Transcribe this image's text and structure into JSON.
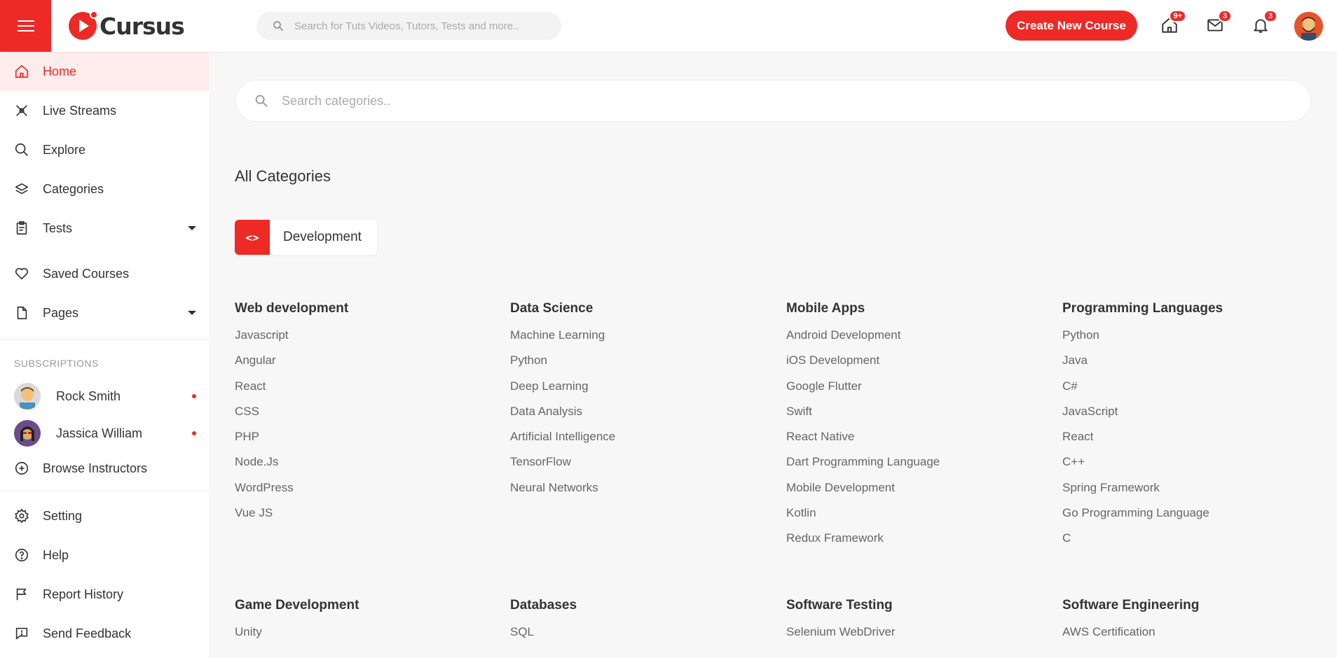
{
  "header": {
    "logo_text": "Cursus",
    "search_placeholder": "Search for Tuts Videos, Tutors, Tests and more..",
    "create_button": "Create New Course",
    "home_badge": "9+",
    "mail_badge": "3",
    "bell_badge": "3",
    "accent_color": "#ed2a26"
  },
  "sidebar": {
    "items": [
      {
        "label": "Home",
        "icon": "home-icon"
      },
      {
        "label": "Live Streams",
        "icon": "live-stream-icon"
      },
      {
        "label": "Explore",
        "icon": "search-icon"
      },
      {
        "label": "Categories",
        "icon": "layers-icon"
      },
      {
        "label": "Tests",
        "icon": "clipboard-icon"
      },
      {
        "label": "Saved Courses",
        "icon": "heart-icon"
      },
      {
        "label": "Pages",
        "icon": "file-icon"
      }
    ],
    "subscriptions_title": "SUBSCRIPTIONS",
    "subscriptions": [
      {
        "name": "Rock Smith"
      },
      {
        "name": "Jassica William"
      }
    ],
    "browse_instructors": "Browse Instructors",
    "bottom_items": [
      {
        "label": "Setting",
        "icon": "gear-icon"
      },
      {
        "label": "Help",
        "icon": "help-icon"
      },
      {
        "label": "Report History",
        "icon": "flag-icon"
      },
      {
        "label": "Send Feedback",
        "icon": "feedback-icon"
      }
    ]
  },
  "main": {
    "search_placeholder": "Search categories..",
    "title": "All Categories",
    "active_category": "Development",
    "groups": [
      {
        "title": "Web development",
        "items": [
          "Javascript",
          "Angular",
          "React",
          "CSS",
          "PHP",
          "Node.Js",
          "WordPress",
          "Vue JS"
        ]
      },
      {
        "title": "Data Science",
        "items": [
          "Machine Learning",
          "Python",
          "Deep Learning",
          "Data Analysis",
          "Artificial Intelligence",
          "TensorFlow",
          "Neural Networks"
        ]
      },
      {
        "title": "Mobile Apps",
        "items": [
          "Android Development",
          "iOS Development",
          "Google Flutter",
          "Swift",
          "React Native",
          "Dart Programming Language",
          "Mobile Development",
          "Kotlin",
          "Redux Framework"
        ]
      },
      {
        "title": "Programming Languages",
        "items": [
          "Python",
          "Java",
          "C#",
          "JavaScript",
          "React",
          "C++",
          "Spring Framework",
          "Go Programming Language",
          "C"
        ]
      },
      {
        "title": "Game Development",
        "items": [
          "Unity"
        ]
      },
      {
        "title": "Databases",
        "items": [
          "SQL"
        ]
      },
      {
        "title": "Software Testing",
        "items": [
          "Selenium WebDriver"
        ]
      },
      {
        "title": "Software Engineering",
        "items": [
          "AWS Certification"
        ]
      }
    ]
  }
}
